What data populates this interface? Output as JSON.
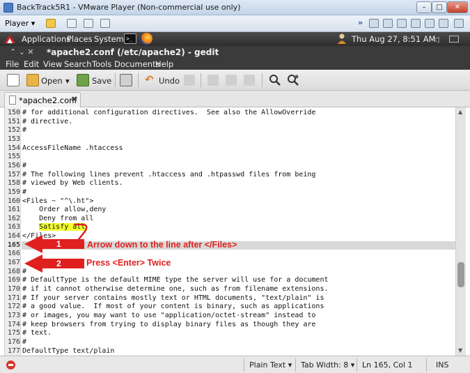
{
  "vm_window": {
    "title": "BackTrack5R1 - VMware Player (Non-commercial use only)",
    "player_menu": "Player ▾",
    "min_label": "–",
    "max_label": "□",
    "close_label": "✕"
  },
  "gnome_panel": {
    "applications": "Applications",
    "places": "Places",
    "system": "System",
    "terminal_glyph": ">_",
    "clock": "Thu Aug 27,  8:51 AM",
    "volume_glyph": "◁"
  },
  "gedit": {
    "window_title": "*apache2.conf (/etc/apache2) - gedit",
    "title_controls": "⌃  ⌄  ✕",
    "menu": [
      "File",
      "Edit",
      "View",
      "Search",
      "Tools",
      "Documents",
      "Help"
    ],
    "toolbar": {
      "open_label": "Open",
      "open_dropdown": "▾",
      "save_label": "Save",
      "undo_label": "Undo"
    },
    "tab_label": "*apache2.conf",
    "tab_close": "✖"
  },
  "editor": {
    "lines": [
      {
        "n": "150",
        "text": "# for additional configuration directives.  See also the AllowOverride"
      },
      {
        "n": "151",
        "text": "# directive."
      },
      {
        "n": "152",
        "text": "#"
      },
      {
        "n": "153",
        "text": ""
      },
      {
        "n": "154",
        "text": "AccessFileName .htaccess"
      },
      {
        "n": "155",
        "text": ""
      },
      {
        "n": "156",
        "text": "#"
      },
      {
        "n": "157",
        "text": "# The following lines prevent .htaccess and .htpasswd files from being"
      },
      {
        "n": "158",
        "text": "# viewed by Web clients."
      },
      {
        "n": "159",
        "text": "#"
      },
      {
        "n": "160",
        "text": "<Files ~ \"^\\.ht\">"
      },
      {
        "n": "161",
        "text": "    Order allow,deny"
      },
      {
        "n": "162",
        "text": "    Deny from all"
      },
      {
        "n": "163",
        "text": "    Satisfy all"
      },
      {
        "n": "164",
        "text": "</Files>"
      },
      {
        "n": "165",
        "text": ""
      },
      {
        "n": "166",
        "text": ""
      },
      {
        "n": "167",
        "text": ""
      },
      {
        "n": "168",
        "text": "#"
      },
      {
        "n": "169",
        "text": "# DefaultType is the default MIME type the server will use for a document"
      },
      {
        "n": "170",
        "text": "# if it cannot otherwise determine one, such as from filename extensions."
      },
      {
        "n": "171",
        "text": "# If your server contains mostly text or HTML documents, \"text/plain\" is"
      },
      {
        "n": "172",
        "text": "# a good value.  If most of your content is binary, such as applications"
      },
      {
        "n": "173",
        "text": "# or images, you may want to use \"application/octet-stream\" instead to"
      },
      {
        "n": "174",
        "text": "# keep browsers from trying to display binary files as though they are"
      },
      {
        "n": "175",
        "text": "# text."
      },
      {
        "n": "176",
        "text": "#"
      },
      {
        "n": "177",
        "text": "DefaultType text/plain"
      }
    ],
    "highlighted_line": "163",
    "current_line": "165",
    "highlight_color": "#f3ff2b"
  },
  "annotations": [
    {
      "number": "1",
      "text": "Arrow down to the line after </Files>"
    },
    {
      "number": "2",
      "text": "Press <Enter> Twice"
    }
  ],
  "annotation_color": "#e0201f",
  "statusbar": {
    "language": "Plain Text ▾",
    "tab_width": "Tab Width:  8 ▾",
    "position": "Ln 165, Col 1",
    "mode": "INS"
  }
}
